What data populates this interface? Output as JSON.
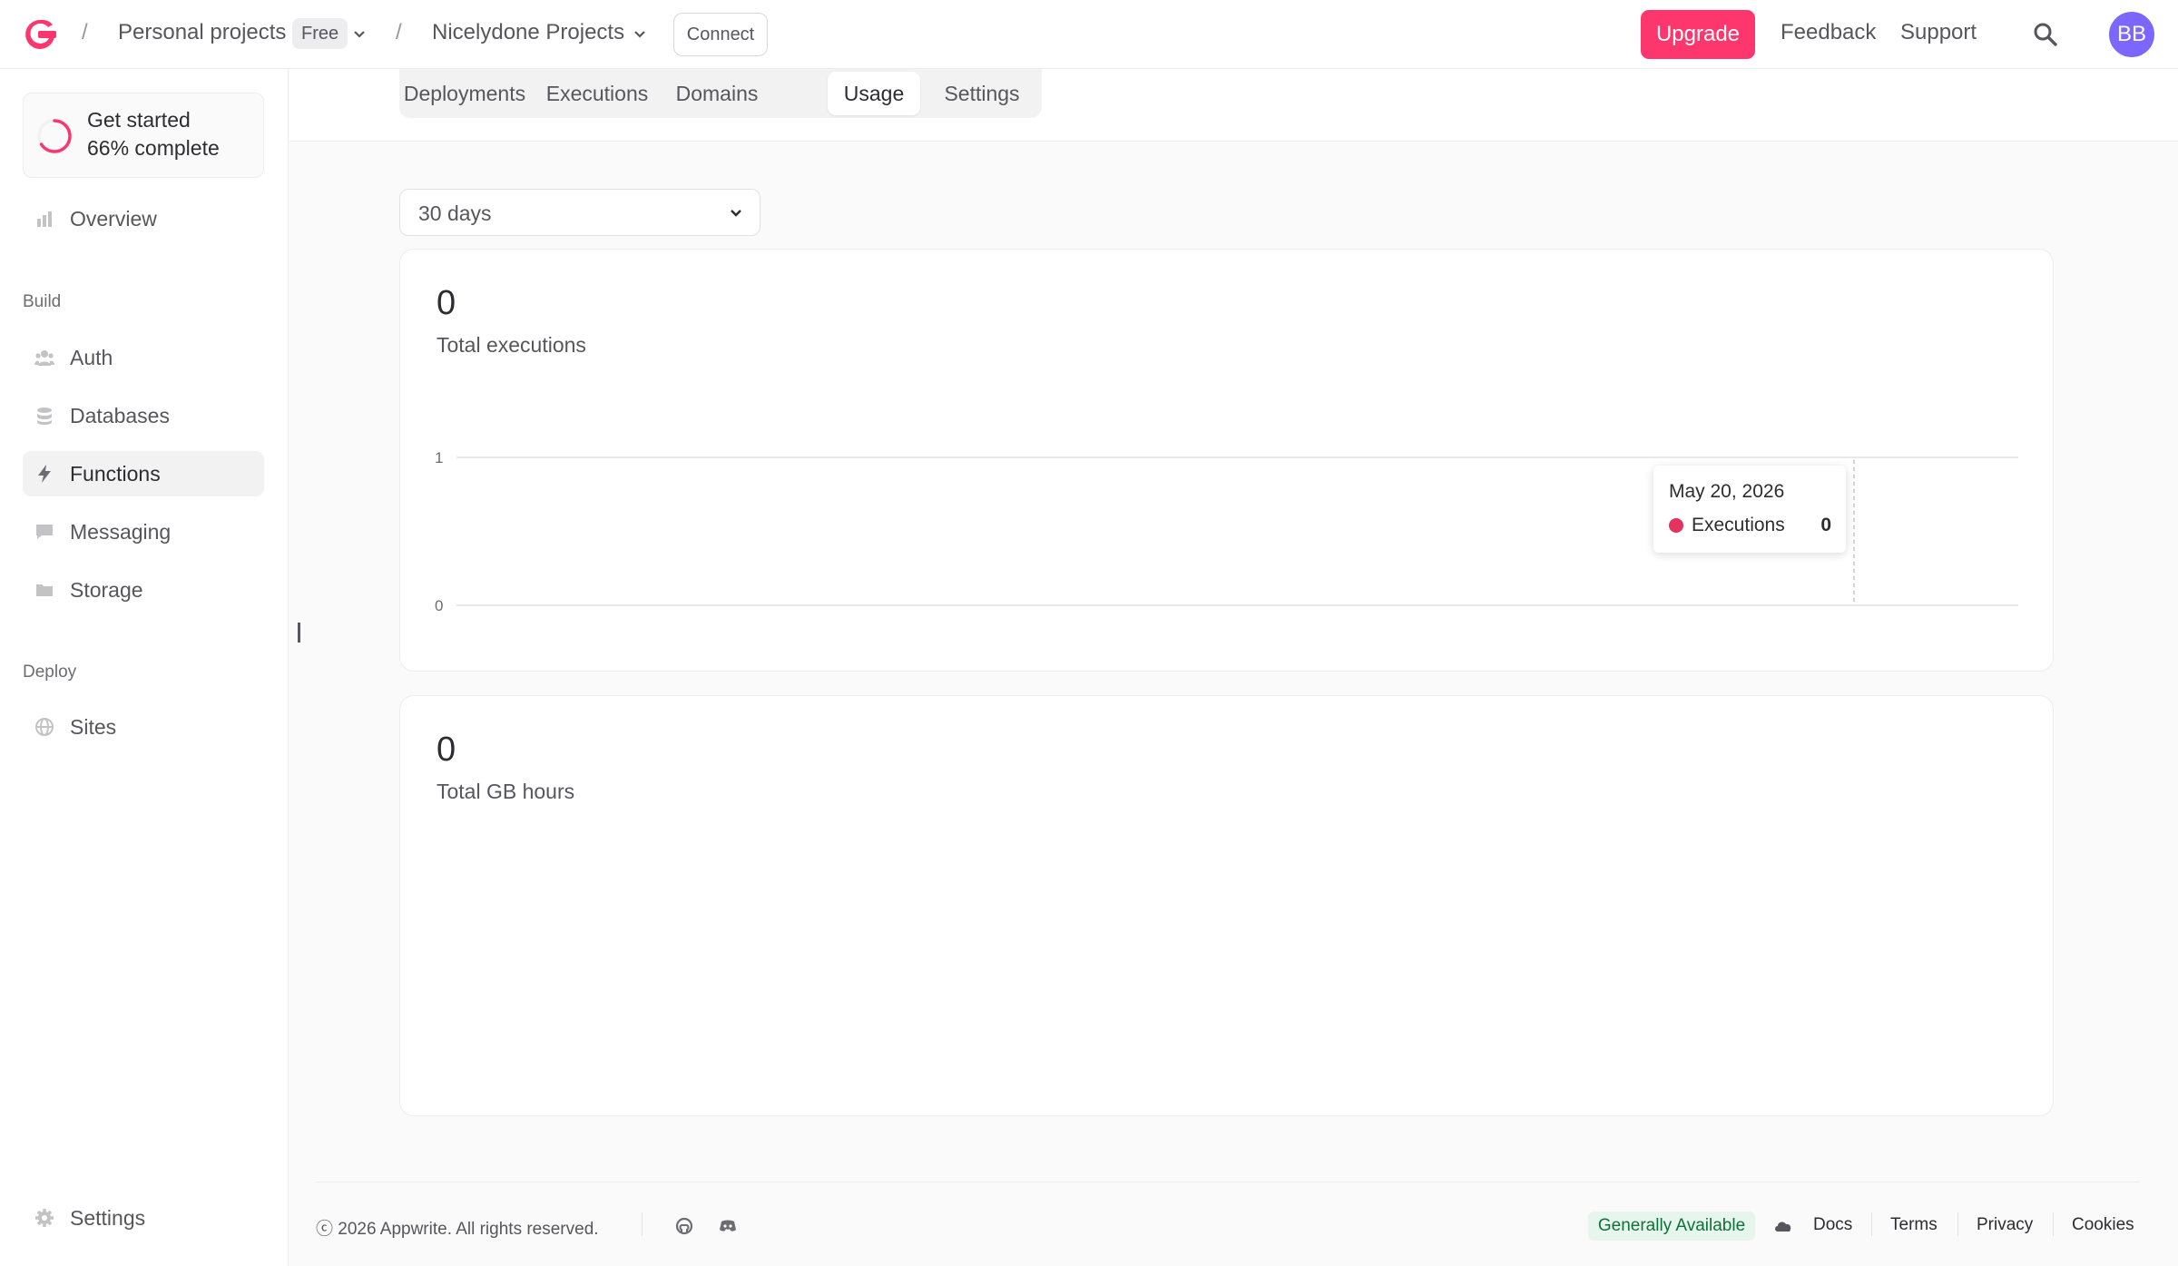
{
  "topbar": {
    "org": "Personal projects",
    "plan_badge": "Free",
    "project": "Nicelydone Projects",
    "connect": "Connect",
    "upgrade": "Upgrade",
    "feedback": "Feedback",
    "support": "Support",
    "avatar": "BB",
    "separator": "/"
  },
  "sidebar": {
    "get_started": {
      "title": "Get started",
      "progress_text": "66% complete",
      "progress": 0.66
    },
    "overview": "Overview",
    "build_section": "Build",
    "build_items": [
      "Auth",
      "Databases",
      "Functions",
      "Messaging",
      "Storage"
    ],
    "deploy_section": "Deploy",
    "deploy_items": [
      "Sites"
    ],
    "settings": "Settings",
    "active_item": "Functions"
  },
  "tabs": [
    "Deployments",
    "Executions",
    "Domains",
    "Usage",
    "Settings"
  ],
  "active_tab": "Usage",
  "period_select": "30 days",
  "cards": {
    "executions": {
      "value": "0",
      "caption": "Total executions"
    },
    "gb_hours": {
      "value": "0",
      "caption": "Total GB hours"
    }
  },
  "chart_data": {
    "type": "line",
    "title": "",
    "xlabel": "",
    "ylabel": "",
    "ylim": [
      0,
      1
    ],
    "y_ticks": [
      "1",
      "0"
    ],
    "series": [
      {
        "name": "Executions",
        "color": "#e4335f",
        "values": [
          0
        ]
      }
    ],
    "tooltip": {
      "date": "May 20, 2026",
      "series": "Executions",
      "value": "0"
    },
    "grid": true
  },
  "footer": {
    "copyright": "ⓒ 2026 Appwrite. All rights reserved.",
    "status": "Generally Available",
    "links": [
      "Docs",
      "Terms",
      "Privacy",
      "Cookies"
    ]
  },
  "colors": {
    "brand": "#fd366e",
    "avatar": "#7c67fe",
    "status_green": "#10703b"
  }
}
